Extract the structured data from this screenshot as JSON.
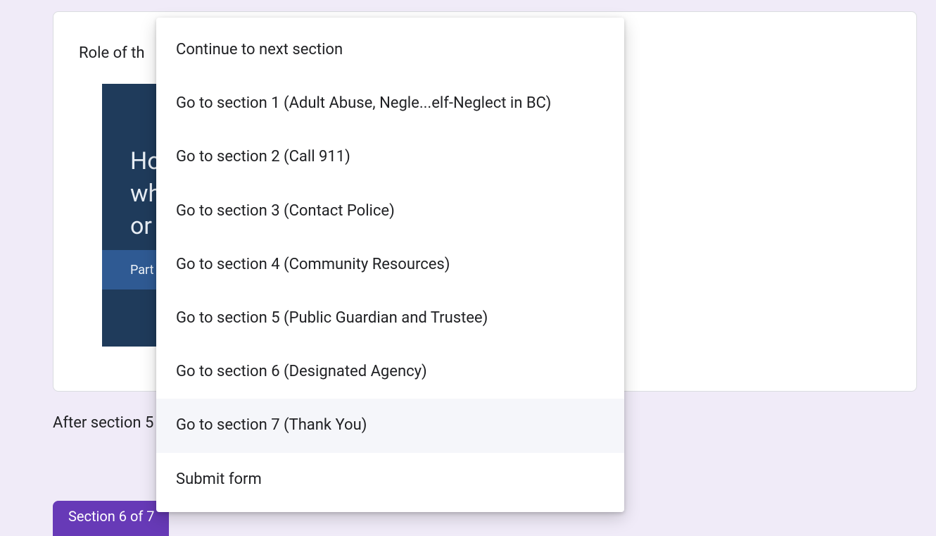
{
  "card": {
    "title": "Role of th"
  },
  "video": {
    "heading_line1": "Ho",
    "heading_line2": "wh",
    "heading_line3": "or ",
    "band_label": "Part"
  },
  "after_section_label": "After section 5",
  "section_chip": "Section 6 of 7",
  "dropdown": {
    "items": [
      {
        "label": "Continue to next section",
        "selected": false
      },
      {
        "label": "Go to section 1 (Adult Abuse, Negle...elf-Neglect in BC)",
        "selected": false
      },
      {
        "label": "Go to section 2 (Call 911)",
        "selected": false
      },
      {
        "label": "Go to section 3 (Contact Police)",
        "selected": false
      },
      {
        "label": "Go to section 4 (Community Resources)",
        "selected": false
      },
      {
        "label": "Go to section 5 (Public Guardian and Trustee)",
        "selected": false
      },
      {
        "label": "Go to section 6 (Designated Agency)",
        "selected": false
      },
      {
        "label": "Go to section 7 (Thank You)",
        "selected": true
      },
      {
        "label": "Submit form",
        "selected": false
      }
    ]
  }
}
